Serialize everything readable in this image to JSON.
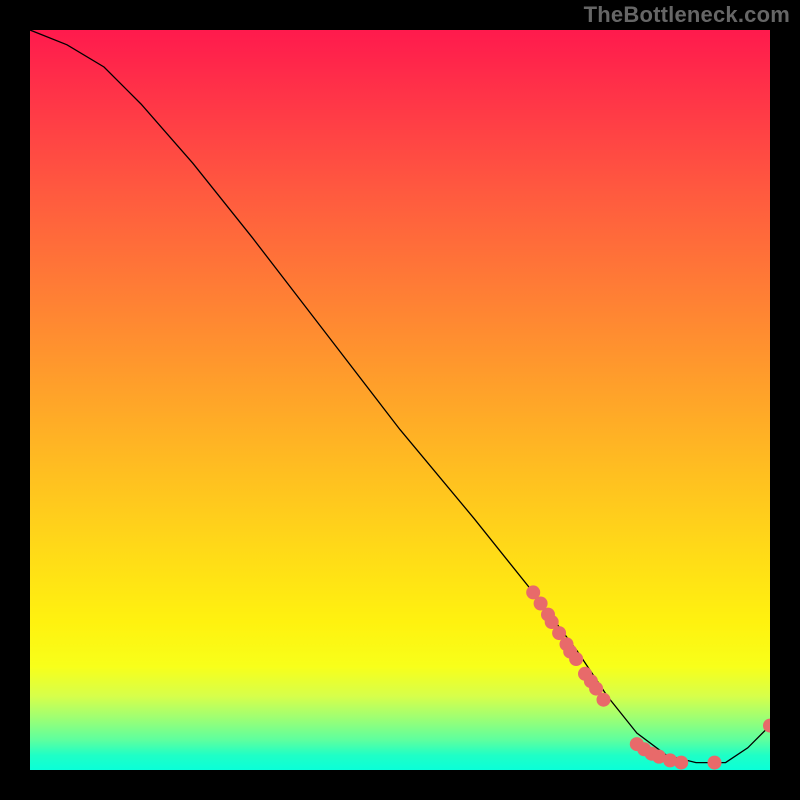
{
  "watermark": "TheBottleneck.com",
  "colors": {
    "background_outer": "#000000",
    "curve": "#000000",
    "dots": "#e86a6a",
    "gradient_top": "#ff1a4d",
    "gradient_bottom": "#0affd8"
  },
  "chart_data": {
    "type": "line",
    "title": "",
    "xlabel": "",
    "ylabel": "",
    "xlim": [
      0,
      100
    ],
    "ylim": [
      0,
      100
    ],
    "grid": false,
    "legend": null,
    "series": [
      {
        "name": "bottleneck-curve",
        "x": [
          0,
          5,
          10,
          15,
          22,
          30,
          40,
          50,
          60,
          68,
          74,
          78,
          82,
          86,
          90,
          94,
          97,
          100
        ],
        "y": [
          100,
          98,
          95,
          90,
          82,
          72,
          59,
          46,
          34,
          24,
          16,
          10,
          5,
          2,
          1,
          1,
          3,
          6
        ]
      }
    ],
    "scatter_cluster": {
      "name": "highlighted-points",
      "points": [
        {
          "x": 68,
          "y": 24
        },
        {
          "x": 69,
          "y": 22.5
        },
        {
          "x": 70,
          "y": 21
        },
        {
          "x": 70.5,
          "y": 20
        },
        {
          "x": 71.5,
          "y": 18.5
        },
        {
          "x": 72.5,
          "y": 17
        },
        {
          "x": 73,
          "y": 16
        },
        {
          "x": 73.8,
          "y": 15
        },
        {
          "x": 75,
          "y": 13
        },
        {
          "x": 75.8,
          "y": 12
        },
        {
          "x": 76.5,
          "y": 11
        },
        {
          "x": 77.5,
          "y": 9.5
        },
        {
          "x": 82,
          "y": 3.5
        },
        {
          "x": 83,
          "y": 2.8
        },
        {
          "x": 84,
          "y": 2.2
        },
        {
          "x": 85,
          "y": 1.8
        },
        {
          "x": 86.5,
          "y": 1.3
        },
        {
          "x": 88,
          "y": 1
        },
        {
          "x": 92.5,
          "y": 1
        },
        {
          "x": 100,
          "y": 6
        }
      ]
    }
  }
}
